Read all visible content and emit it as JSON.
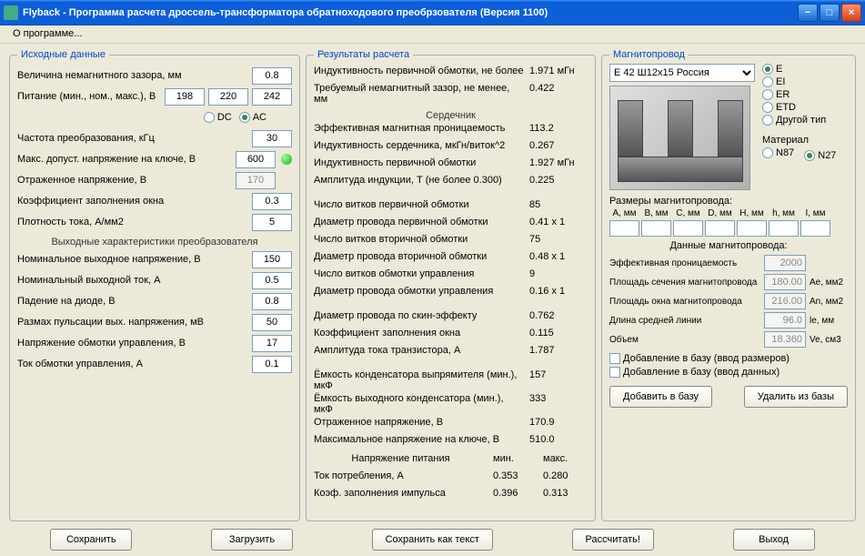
{
  "window": {
    "title": "Flyback - Программа расчета дроссель-трансформатора обратноходового преобрзователя (Версия 1100)"
  },
  "menu": {
    "about": "О программе..."
  },
  "left": {
    "legend": "Исходные данные",
    "gap_label": "Величина немагнитного зазора, мм",
    "gap": "0.8",
    "supply_label": "Питание (мин., ном., макс.), В",
    "vmin": "198",
    "vnom": "220",
    "vmax": "242",
    "dc": "DC",
    "ac": "AC",
    "freq_label": "Частота преобразования, кГц",
    "freq": "30",
    "vds_label": "Макс. допуст. напряжение на ключе, В",
    "vds": "600",
    "vref_label": "Отраженное напряжение, В",
    "vref": "170",
    "kfill_label": "Коэффициент заполнения окна",
    "kfill": "0.3",
    "jdens_label": "Плотность тока, А/мм2",
    "jdens": "5",
    "out_legend": "Выходные характеристики преобразователя",
    "vout_label": "Номинальное выходное напряжение, В",
    "vout": "150",
    "iout_label": "Номинальный выходной ток, А",
    "iout": "0.5",
    "vdiode_label": "Падение на диоде, В",
    "vdiode": "0.8",
    "ripple_label": "Размах пульсации вых. напряжения, мВ",
    "ripple": "50",
    "vaux_label": "Напряжение обмотки управления, В",
    "vaux": "17",
    "iaux_label": "Ток обмотки управления, А",
    "iaux": "0.1"
  },
  "center": {
    "legend": "Результаты расчета",
    "lprim_label": "Индуктивность первичной обмотки, не более",
    "lprim": "1.971 мГн",
    "reqgap_label": "Требуемый немагнитный зазор, не менее, мм",
    "reqgap": "0.422",
    "core_section": "Сердечник",
    "mu_label": "Эффективная магнитная проницаемость",
    "mu": "113.2",
    "al_label": "Индуктивность сердечника, мкГн/виток^2",
    "al": "0.267",
    "lprim2_label": "Индуктивность первичной обмотки",
    "lprim2": "1.927 мГн",
    "bmax_label": "Амплитуда индукции, Т     (не более 0.300)",
    "bmax": "0.225",
    "n1_label": "Число витков первичной обмотки",
    "n1": "85",
    "d1_label": "Диаметр провода первичной обмотки",
    "d1": "0.41 x 1",
    "n2_label": "Число витков вторичной обмотки",
    "n2": "75",
    "d2_label": "Диаметр провода вторичной обмотки",
    "d2": "0.48 x 1",
    "n3_label": "Число витков обмотки управления",
    "n3": "9",
    "d3_label": "Диаметр провода обмотки управления",
    "d3": "0.16 x 1",
    "dskin_label": "Диаметр провода по скин-эффекту",
    "dskin": "0.762",
    "kfill_res_label": "Коэффициент заполнения окна",
    "kfill_res": "0.115",
    "itr_label": "Амплитуда тока транзистора, А",
    "itr": "1.787",
    "crect_label": "Ёмкость конденсатора выпрямителя (мин.), мкФ",
    "crect": "157",
    "cout_label": "Ёмкость выходного конденсатора (мин.), мкФ",
    "cout": "333",
    "vrefl_label": "Отраженное напряжение, В",
    "vrefl": "170.9",
    "vdsmax_label": "Максимальное напряжение на ключе, В",
    "vdsmax": "510.0",
    "supply_section": "Напряжение питания",
    "min_hdr": "мин.",
    "max_hdr": "макс.",
    "iin_label": "Ток потребления, А",
    "iin_min": "0.353",
    "iin_max": "0.280",
    "duty_label": "Коэф. заполнения импульса",
    "duty_min": "0.396",
    "duty_max": "0.313"
  },
  "right": {
    "legend": "Магнитопровод",
    "core_select": "E 42 Ш12x15 Россия",
    "types": {
      "e": "E",
      "ei": "EI",
      "er": "ER",
      "etd": "ETD",
      "other": "Другой тип"
    },
    "material_label": "Материал",
    "mat_n87": "N87",
    "mat_n27": "N27",
    "dims_label": "Размеры магнитопровода:",
    "dim_headers": [
      "A, мм",
      "B, мм",
      "C, мм",
      "D, мм",
      "H, мм",
      "h, мм",
      "I, мм"
    ],
    "data_label": "Данные магнитопровода:",
    "mu_eff_label": "Эффективная проницаемость",
    "mu_eff": "2000",
    "ae_label": "Площадь сечения магнитопровода",
    "ae": "180.00",
    "ae_unit": "Ae, мм2",
    "aw_label": "Площадь окна магнитопровода",
    "aw": "216.00",
    "aw_unit": "An, мм2",
    "le_label": "Длина средней линии",
    "le": "96.0",
    "le_unit": "le, мм",
    "ve_label": "Объем",
    "ve": "18.360",
    "ve_unit": "Ve, см3",
    "cb_dims": "Добавление в базу (ввод размеров)",
    "cb_data": "Добавление в базу (ввод данных)",
    "btn_add": "Добавить в базу",
    "btn_del": "Удалить из базы"
  },
  "buttons": {
    "save": "Сохранить",
    "load": "Загрузить",
    "savetxt": "Сохранить как текст",
    "calc": "Рассчитать!",
    "exit": "Выход"
  }
}
